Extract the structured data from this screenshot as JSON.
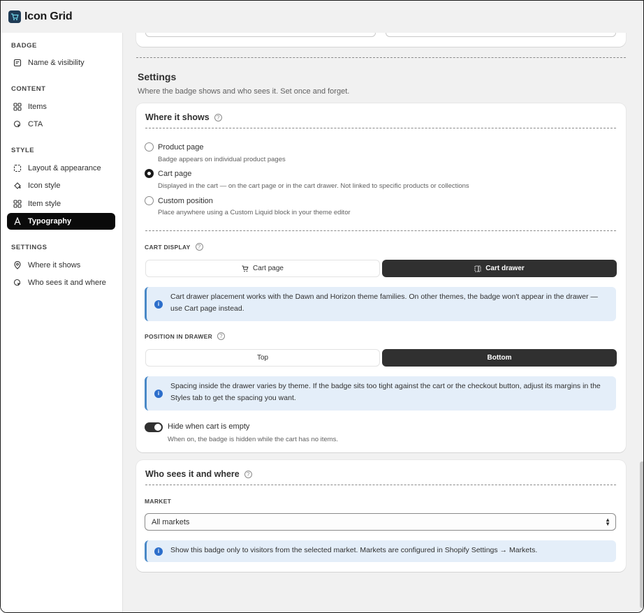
{
  "app": {
    "title": "Icon Grid"
  },
  "sidebar": {
    "sections": [
      {
        "label": "BADGE",
        "items": [
          {
            "label": "Name & visibility",
            "icon": "note-icon"
          }
        ]
      },
      {
        "label": "CONTENT",
        "items": [
          {
            "label": "Items",
            "icon": "grid-icon"
          },
          {
            "label": "CTA",
            "icon": "cursor-click-icon"
          }
        ]
      },
      {
        "label": "STYLE",
        "items": [
          {
            "label": "Layout & appearance",
            "icon": "layout-icon"
          },
          {
            "label": "Icon style",
            "icon": "paint-bucket-icon"
          },
          {
            "label": "Item style",
            "icon": "grid-icon"
          },
          {
            "label": "Typography",
            "icon": "text-icon",
            "active": true
          }
        ]
      },
      {
        "label": "SETTINGS",
        "items": [
          {
            "label": "Where it shows",
            "icon": "location-pin-icon"
          },
          {
            "label": "Who sees it and where",
            "icon": "globe-cursor-icon"
          }
        ]
      }
    ]
  },
  "settings": {
    "heading": "Settings",
    "description": "Where the badge shows and who sees it. Set once and forget."
  },
  "where_it_shows": {
    "title": "Where it shows",
    "options": [
      {
        "label": "Product page",
        "description": "Badge appears on individual product pages",
        "selected": false
      },
      {
        "label": "Cart page",
        "description": "Displayed in the cart — on the cart page or in the cart drawer. Not linked to specific products or collections",
        "selected": true
      },
      {
        "label": "Custom position",
        "description": "Place anywhere using a Custom Liquid block in your theme editor",
        "selected": false
      }
    ],
    "cart_display": {
      "label": "CART DISPLAY",
      "options": [
        {
          "label": "Cart page",
          "icon": "cart-icon"
        },
        {
          "label": "Cart drawer",
          "icon": "drawer-icon",
          "selected": true
        }
      ]
    },
    "drawer_notice": "Cart drawer placement works with the Dawn and Horizon theme families. On other themes, the badge won't appear in the drawer — use Cart page instead.",
    "position_in_drawer": {
      "label": "POSITION IN DRAWER",
      "options": [
        {
          "label": "Top"
        },
        {
          "label": "Bottom",
          "selected": true
        }
      ]
    },
    "spacing_notice": "Spacing inside the drawer varies by theme. If the badge sits too tight against the cart or the checkout button, adjust its margins in the Styles tab to get the spacing you want.",
    "hide_when_empty": {
      "label": "Hide when cart is empty",
      "description": "When on, the badge is hidden while the cart has no items.",
      "enabled": true
    }
  },
  "who_sees": {
    "title": "Who sees it and where",
    "market_label": "MARKET",
    "market_value": "All markets",
    "notice": "Show this badge only to visitors from the selected market. Markets are configured in Shopify Settings → Markets."
  },
  "colors": {
    "active_nav": "#0a0a0a",
    "segment_active": "#303030",
    "info_banner": "#e4eef9",
    "info_icon": "#2c6ecb"
  }
}
